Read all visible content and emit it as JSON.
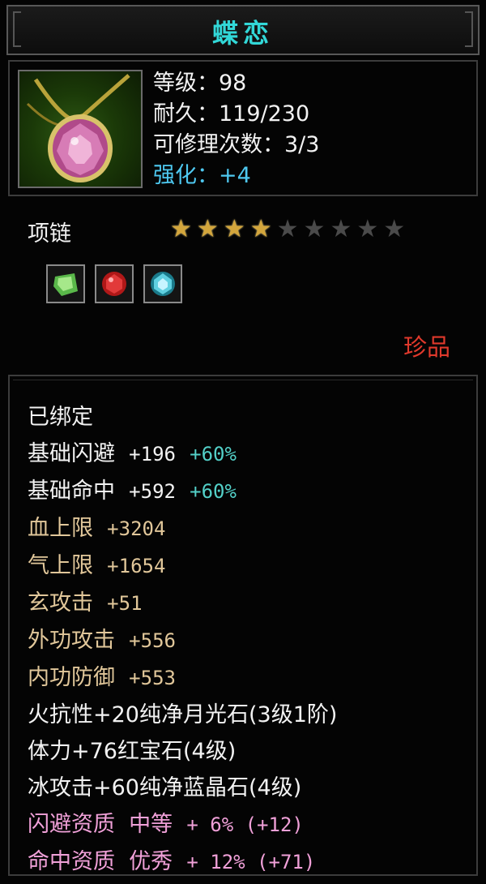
{
  "title": "蝶恋",
  "item": {
    "icon": "pink-gem-necklace-icon",
    "stats": {
      "level": "等级：98",
      "durability": "耐久：119/230",
      "repairs": "可修理次数：3/3",
      "enhance": "强化：+4"
    },
    "type": "项链",
    "stars": {
      "filled": 4,
      "total": 9
    },
    "gems": [
      "green-crystal-icon",
      "red-ruby-icon",
      "blue-crystal-icon"
    ],
    "rarity": "珍品"
  },
  "colors": {
    "title": "#32d8d8",
    "enhance": "#4ec8f0",
    "rarity": "#e0392c",
    "tan": "#e1c79a",
    "pink": "#f0a0d8",
    "teal": "#53d0c8"
  },
  "attributes": {
    "bound": "已绑定",
    "dodge": {
      "name": "基础闪避",
      "value": "+196",
      "bonus": "+60%"
    },
    "hit": {
      "name": "基础命中",
      "value": "+592",
      "bonus": "+60%"
    },
    "hp": {
      "name": "血上限",
      "value": "+3204"
    },
    "qi": {
      "name": "气上限",
      "value": "+1654"
    },
    "xuan": {
      "name": "玄攻击",
      "value": "+51"
    },
    "outer_attack": {
      "name": "外功攻击",
      "value": "+556"
    },
    "inner_defense": {
      "name": "内功防御",
      "value": "+553"
    },
    "gem1": "火抗性+20纯净月光石(3级1阶)",
    "gem2": "体力+76红宝石(4级)",
    "gem3": "冰攻击+60纯净蓝晶石(4级)",
    "aptitude_dodge": {
      "name": "闪避资质",
      "grade": "中等",
      "value": "+ 6% (+12)"
    },
    "aptitude_hit": {
      "name": "命中资质",
      "grade": "优秀",
      "value": "+ 12% (+71)"
    }
  }
}
